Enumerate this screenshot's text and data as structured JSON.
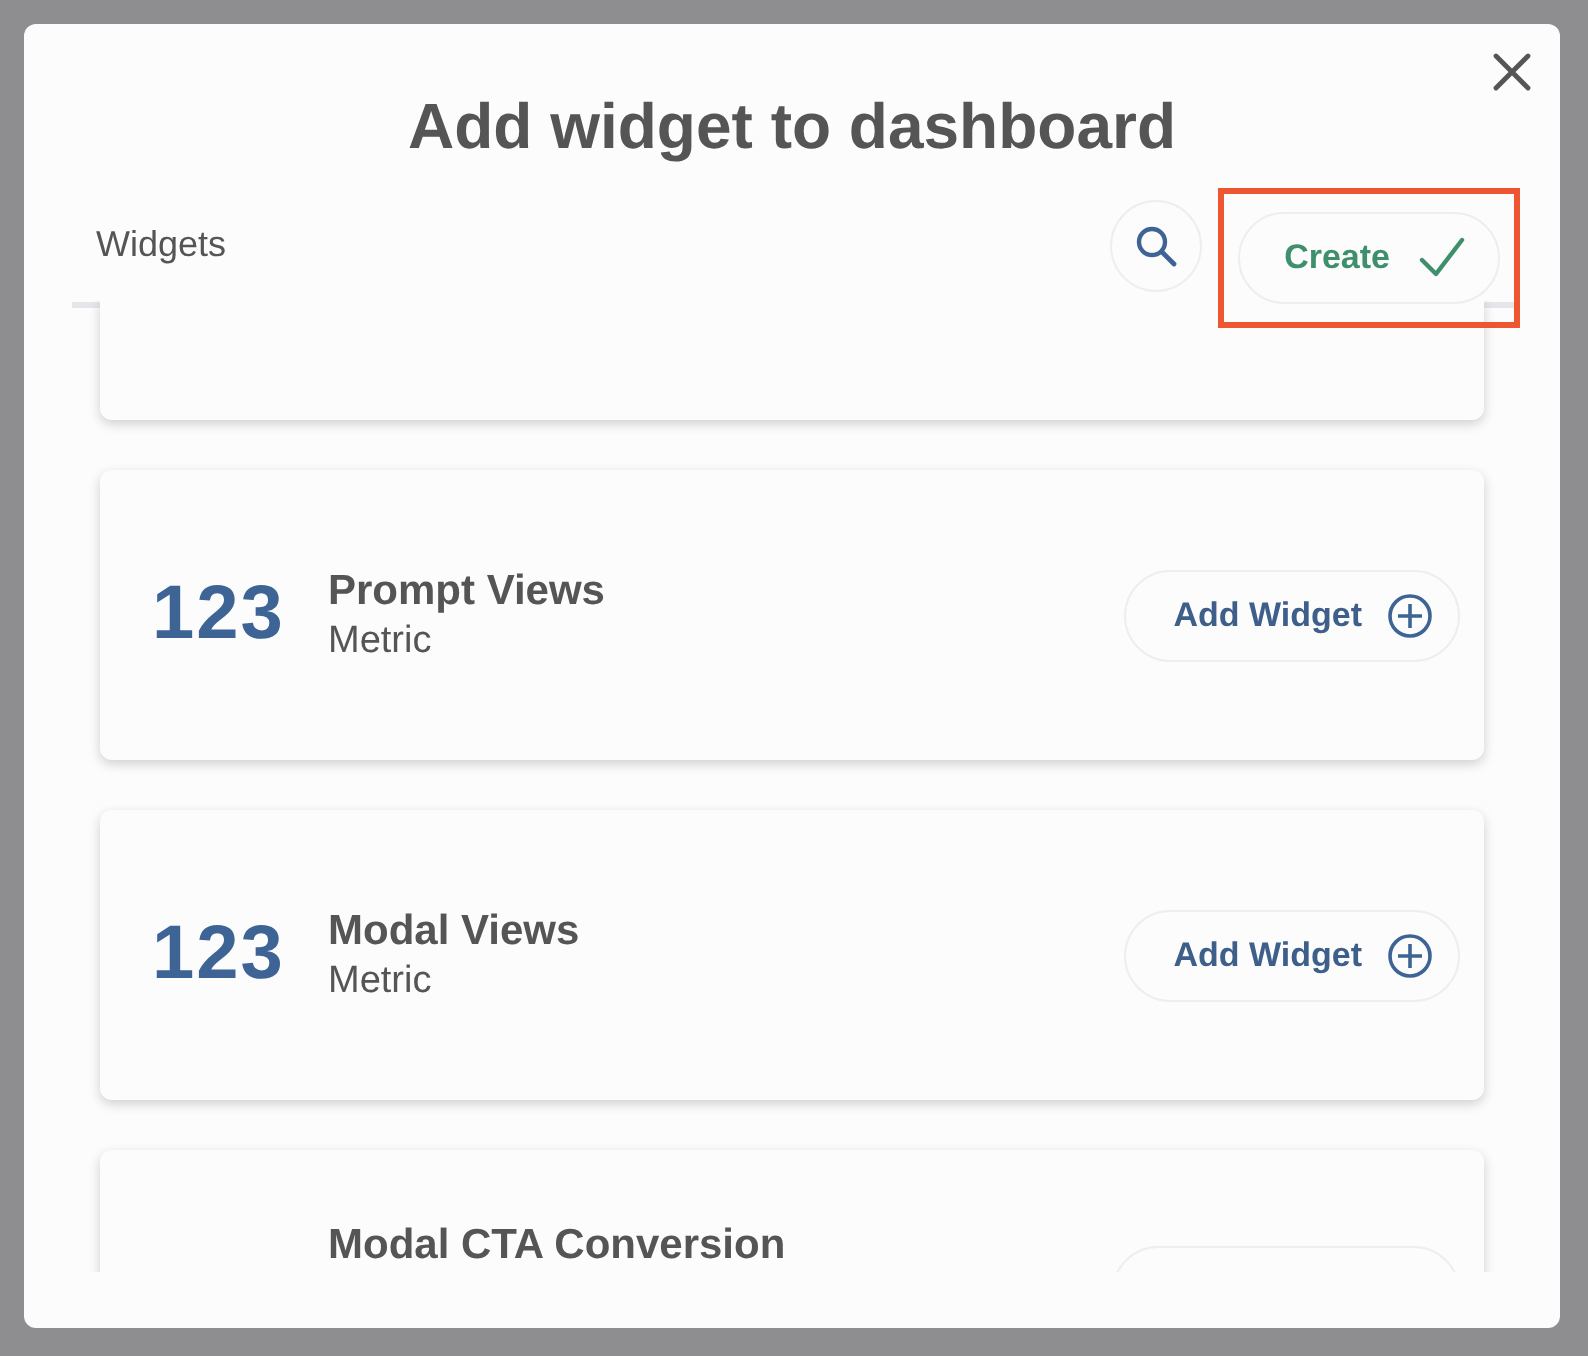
{
  "dialog": {
    "title": "Add widget to dashboard"
  },
  "header": {
    "label": "Widgets",
    "create_button": {
      "label": "Create",
      "highlighted": true
    }
  },
  "widgets": [
    {
      "kind": "clipped"
    },
    {
      "kind": "metric",
      "icon_text": "123",
      "title": "Prompt Views",
      "subtitle": "Metric",
      "button": "Add Widget"
    },
    {
      "kind": "metric",
      "icon_text": "123",
      "title": "Modal Views",
      "subtitle": "Metric",
      "button": "Add Widget"
    },
    {
      "kind": "partial",
      "title": "Modal CTA Conversion"
    }
  ]
}
